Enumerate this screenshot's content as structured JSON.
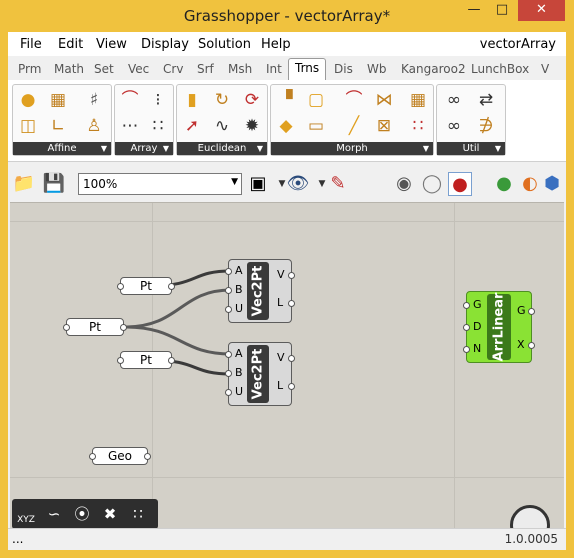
{
  "window": {
    "title": "Grasshopper - vectorArray*",
    "minimize_glyph": "—",
    "maximize_glyph": "□",
    "close_glyph": "✕"
  },
  "menu": {
    "items": [
      "File",
      "Edit",
      "View",
      "Display",
      "Solution",
      "Help"
    ],
    "document_name": "vectorArray"
  },
  "tabs": [
    "Prm",
    "Math",
    "Set",
    "Vec",
    "Crv",
    "Srf",
    "Msh",
    "Int",
    "Trns",
    "Dis",
    "Wb",
    "Kangaroo2",
    "LunchBox",
    "V"
  ],
  "active_tab": "Trns",
  "ribbon": {
    "groups": [
      "Affine",
      "Array",
      "Euclidean",
      "Morph",
      "Util"
    ],
    "group_arrow": "▼"
  },
  "toolbar": {
    "zoom_value": "100%",
    "zoom_caret": "▼"
  },
  "canvas": {
    "params": [
      {
        "label": "Pt"
      },
      {
        "label": "Pt"
      },
      {
        "label": "Pt"
      },
      {
        "label": "Geo"
      }
    ],
    "components": [
      {
        "nickname": "Vec2Pt",
        "inputs": [
          "A",
          "B",
          "U"
        ],
        "outputs": [
          "V",
          "L"
        ]
      },
      {
        "nickname": "Vec2Pt",
        "inputs": [
          "A",
          "B",
          "U"
        ],
        "outputs": [
          "V",
          "L"
        ]
      },
      {
        "nickname": "ArrLinear",
        "inputs": [
          "G",
          "D",
          "N"
        ],
        "outputs": [
          "G",
          "X"
        ]
      }
    ]
  },
  "bottom_tools": {
    "xyz_label": "XYZ"
  },
  "status": {
    "left": "...",
    "right": "1.0.0005"
  },
  "colors": {
    "titlebar": "#f0c23e",
    "close_button": "#c7463a",
    "canvas": "#d3d0c8",
    "component": "#d9d9d9",
    "selected_component": "#8ae234"
  }
}
